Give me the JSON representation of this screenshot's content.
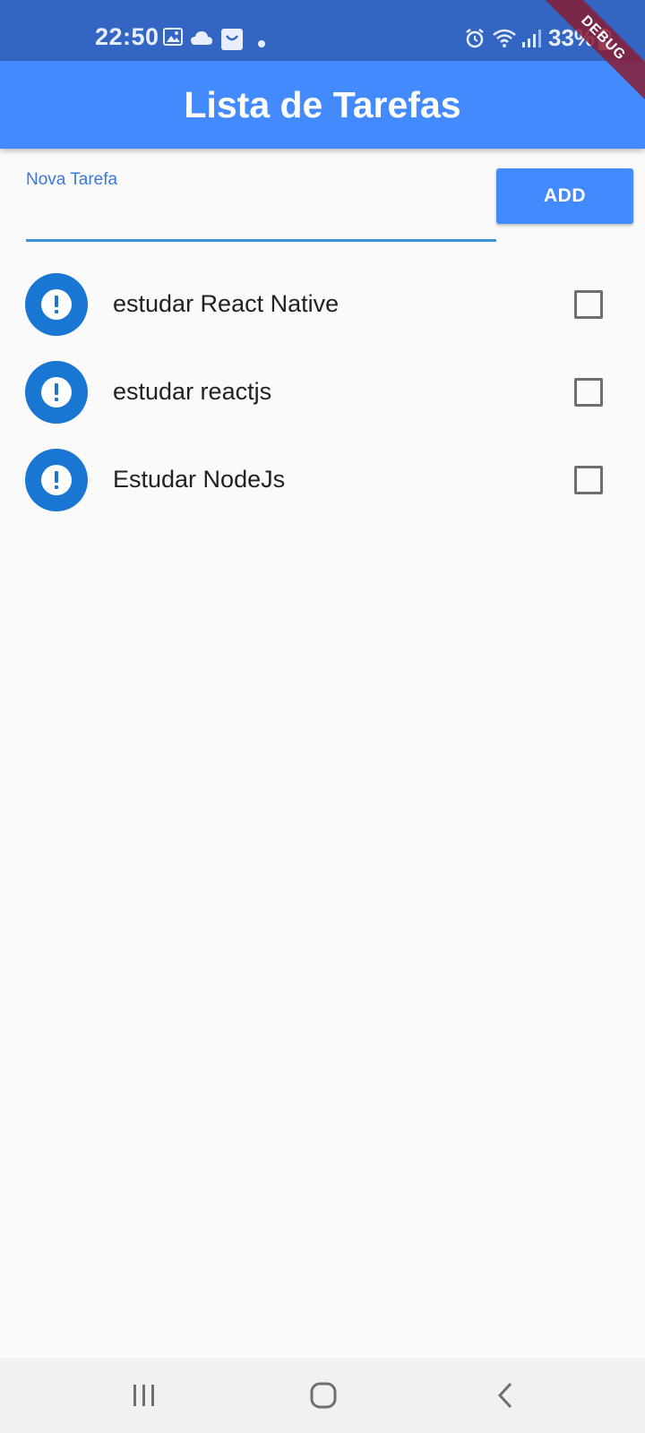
{
  "status_bar": {
    "time": "22:50",
    "battery": "33%",
    "icons": [
      "image-icon",
      "cloud-icon",
      "bag-icon",
      "dot-icon",
      "alarm-icon",
      "wifi-icon",
      "signal-icon",
      "battery-icon"
    ]
  },
  "debug_banner": "DEBUG",
  "app_bar": {
    "title": "Lista de Tarefas"
  },
  "form": {
    "label": "Nova Tarefa",
    "value": "",
    "add_label": "ADD"
  },
  "tasks": [
    {
      "label": "estudar React Native",
      "checked": false,
      "icon": "error-icon"
    },
    {
      "label": "estudar reactjs",
      "checked": false,
      "icon": "error-icon"
    },
    {
      "label": "Estudar NodeJs",
      "checked": false,
      "icon": "error-icon"
    }
  ],
  "nav_bar": {
    "buttons": [
      "recent-apps-icon",
      "home-icon",
      "back-icon"
    ]
  },
  "colors": {
    "status_bar": "#3366c2",
    "app_bar": "#448aff",
    "accent": "#1976d2",
    "background": "#fafafa"
  }
}
